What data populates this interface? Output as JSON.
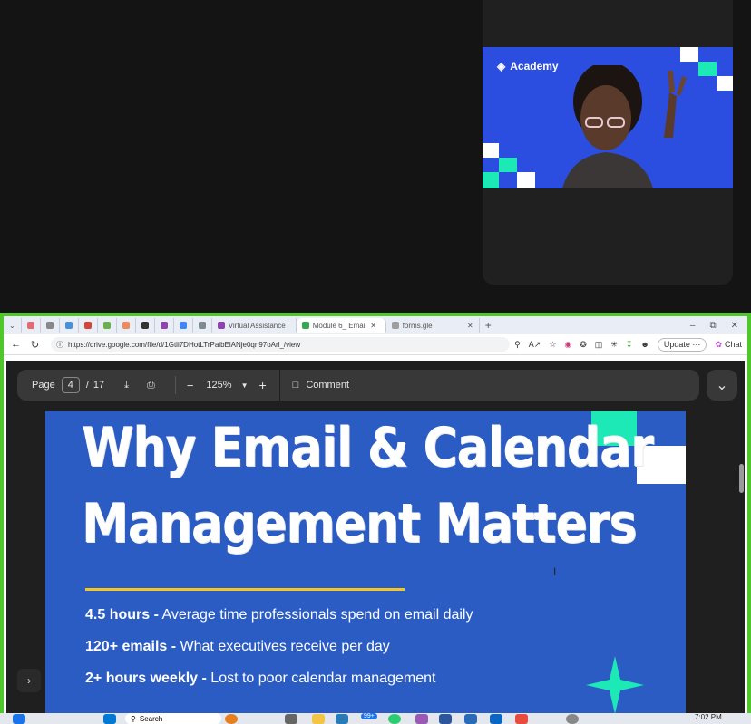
{
  "video_tile": {
    "logo_text": "Academy"
  },
  "browser": {
    "tabs": [
      {
        "label": "",
        "color": "#e06c75"
      },
      {
        "label": "",
        "color": "#888888"
      },
      {
        "label": "",
        "color": "#4a90d9"
      },
      {
        "label": "",
        "color": "#d44638"
      },
      {
        "label": "",
        "color": "#6ab04c"
      },
      {
        "label": "",
        "color": "#f08a5d"
      },
      {
        "label": "",
        "color": "#333333"
      },
      {
        "label": "",
        "color": "#8e44ad"
      },
      {
        "label": "",
        "color": "#4285f4"
      },
      {
        "label": "",
        "color": "#7f8c8d"
      },
      {
        "label": "Virtual Assistance",
        "color": "#8e44ad"
      },
      {
        "label": "Module 6_ Email",
        "color": "#34a853",
        "active": true
      },
      {
        "label": "forms.gle",
        "color": "#9e9e9e"
      }
    ],
    "url": "https://drive.google.com/file/d/1Gtli7DHotLTrPaibElANje0qn97oArl_/view",
    "update_label": "Update",
    "chat_label": "Chat"
  },
  "pdf_toolbar": {
    "page_label": "Page",
    "current_page": "4",
    "separator": "/",
    "total_pages": "17",
    "zoom": "125%",
    "comment_label": "Comment"
  },
  "slide": {
    "title_line1": "Why Email & Calendar",
    "title_line2": "Management Matters",
    "stats": [
      {
        "bold": "4.5 hours -",
        "text": " Average time professionals spend on email daily"
      },
      {
        "bold": "120+ emails -",
        "text": " What executives receive per day"
      },
      {
        "bold": "2+ hours weekly -",
        "text": " Lost to poor calendar management"
      }
    ],
    "colors": {
      "background": "#2b5cc4",
      "accent_teal": "#1de9b6",
      "rule_yellow": "#f3c623"
    }
  },
  "taskbar": {
    "search_label": "Search",
    "badge": "99+",
    "time": "7:02 PM"
  }
}
